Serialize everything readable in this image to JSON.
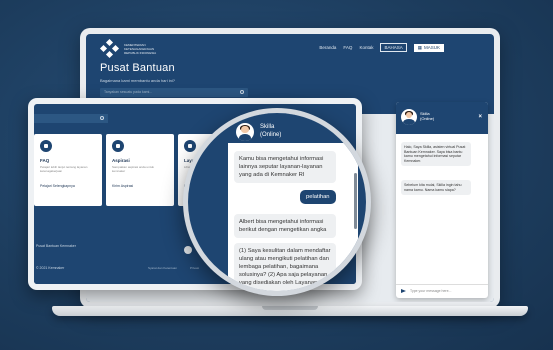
{
  "laptop": {
    "logo_text": "KEMENTERIAN KETENAGAKERJAAN REPUBLIK INDONESIA",
    "nav": [
      "Beranda",
      "FAQ",
      "Kontak"
    ],
    "lang_button": "BAHASA",
    "login_button": "MASUK",
    "title": "Pusat Bantuan",
    "subtitle": "Bagaimana kami membantu anda hari ini?",
    "search_placeholder": "Tanyakan sesuatu pada kami...",
    "chat": {
      "name": "Skilla",
      "status": "(Online)",
      "greeting": "Halo, Saya Skilla, asisten virtual Pusat Bantuan Kemnaker. Saya bisa bantu kamu mengetahui informasi seputar Kemnaker.",
      "prompt": "Sebelum kita mulai, Skilla ingin tahu nama kamu. Nama kamu siapa?",
      "input_placeholder": "Type your message here..."
    }
  },
  "tablet": {
    "cards": [
      {
        "title": "FAQ",
        "desc": "Pelajari lebih lanjut tentang layanan ketenagakerjaan",
        "link": "Pelajari Selengkapnya"
      },
      {
        "title": "Aspirasi",
        "desc": "Sampaikan aspirasi anda untuk kemnaker",
        "link": "Kirim Aspirasi"
      },
      {
        "title": "Layanan",
        "desc": "Lihat layanan Kemnaker",
        "link": "Buat"
      }
    ],
    "footer_left": "Pusat Bantuan Kemnaker",
    "footer_copy": "© 2021 Kemnaker",
    "footer_link_1": "Syarat dan Ketentuan",
    "footer_link_2": "Privasi"
  },
  "magnifier": {
    "name": "Skilla",
    "status": "(Online)",
    "bubble_1": "Kamu bisa mengetahui informasi lainnya seputar layanan-layanan yang ada di Kemnaker RI",
    "user_reply": "pelatihan",
    "bubble_2": "Albert bisa mengetahui informasi berikut dengan mengetikan angka",
    "bubble_3": "(1) Saya kesulitan dalam mendaftar ulang atau mengikuti pelatihan dan lembaga pelatihan, bagaimana solusinya? (2) Apa saja pelayanan yang disediakan oleh Layanan"
  }
}
